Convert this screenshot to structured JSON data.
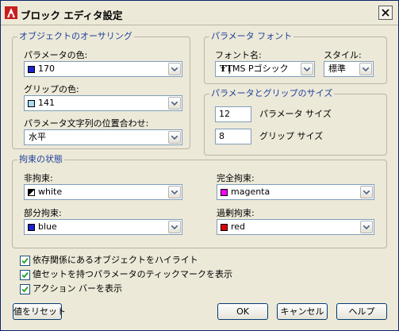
{
  "window": {
    "title": "ブロック エディタ設定"
  },
  "object_highlight": {
    "title": "オブジェクトのオーサリング",
    "param_color_label": "パラメータの色:",
    "param_color_value": "170",
    "param_color_swatch": "#1a23c8",
    "grip_color_label": "グリップの色:",
    "grip_color_value": "141",
    "grip_color_swatch": "#a8dcf0",
    "text_align_label": "パラメータ文字列の位置合わせ:",
    "text_align_value": "水平"
  },
  "param_font": {
    "title": "パラメータ フォント",
    "font_name_label": "フォント名:",
    "font_name_value": "MS Pゴシック",
    "style_label": "スタイル:",
    "style_value": "標準"
  },
  "param_grip_size": {
    "title": "パラメータとグリップのサイズ",
    "param_size_value": "12",
    "param_size_label": "パラメータ サイズ",
    "grip_size_value": "8",
    "grip_size_label": "グリップ サイズ"
  },
  "constraint_status": {
    "title": "拘束の状態",
    "unconstrained_label": "非拘束:",
    "unconstrained_value": "white",
    "fully_label": "完全拘束:",
    "fully_value": "magenta",
    "fully_swatch": "#ff00ff",
    "partial_label": "部分拘束:",
    "partial_value": "blue",
    "partial_swatch": "#1a23c8",
    "over_label": "過剰拘束:",
    "over_value": "red",
    "over_swatch": "#e00000"
  },
  "options": {
    "highlight_dependent": {
      "label": "依存関係にあるオブジェクトをハイライト",
      "checked": true
    },
    "show_tick_marks": {
      "label": "値セットを持つパラメータのティックマークを表示",
      "checked": true
    },
    "show_action_bar": {
      "label": "アクション バーを表示",
      "checked": true
    }
  },
  "buttons": {
    "reset": "値をリセット",
    "ok": "OK",
    "cancel": "キャンセル",
    "help": "ヘルプ"
  }
}
